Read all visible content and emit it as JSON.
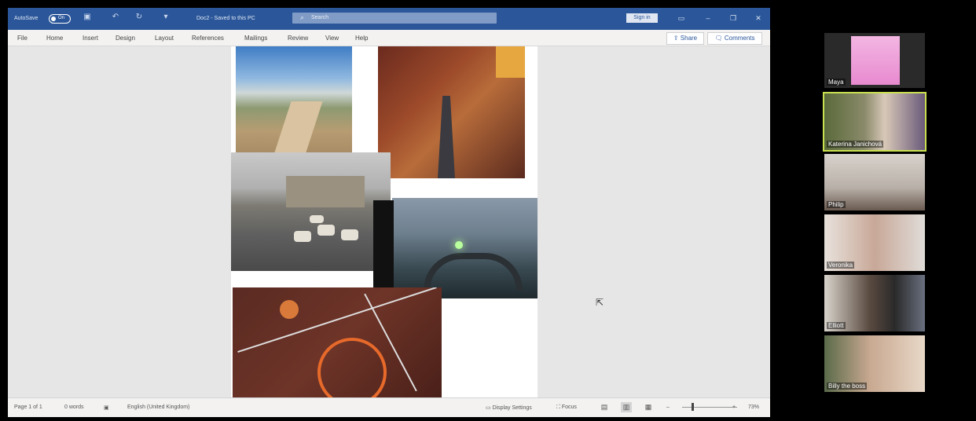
{
  "word": {
    "titlebar": {
      "autosave_label": "AutoSave",
      "autosave_state": "On",
      "document_title": "Doc2 - Saved to this PC",
      "search_placeholder": "Search",
      "signin_label": "Sign in"
    },
    "ribbon": {
      "tabs": [
        "File",
        "Home",
        "Insert",
        "Design",
        "Layout",
        "References",
        "Mailings",
        "Review",
        "View",
        "Help"
      ],
      "share_label": "Share",
      "comments_label": "Comments"
    },
    "statusbar": {
      "page_info": "Page 1 of 1",
      "word_count": "0 words",
      "language": "English (United Kingdom)",
      "display_settings": "Display Settings",
      "focus": "Focus",
      "zoom": "73%"
    },
    "icons": [
      "save-icon",
      "undo-icon",
      "redo-icon",
      "search-icon",
      "share-icon",
      "comments-icon",
      "cursor-icon"
    ]
  },
  "participants": [
    {
      "name": "Maya"
    },
    {
      "name": "Katerina Janichová"
    },
    {
      "name": "Philip"
    },
    {
      "name": "Veronika"
    },
    {
      "name": "Elliott"
    },
    {
      "name": "Billy the boss"
    }
  ],
  "colors": {
    "word_blue": "#2b579a",
    "active_speaker": "#c9e04f",
    "background": "#000000"
  }
}
